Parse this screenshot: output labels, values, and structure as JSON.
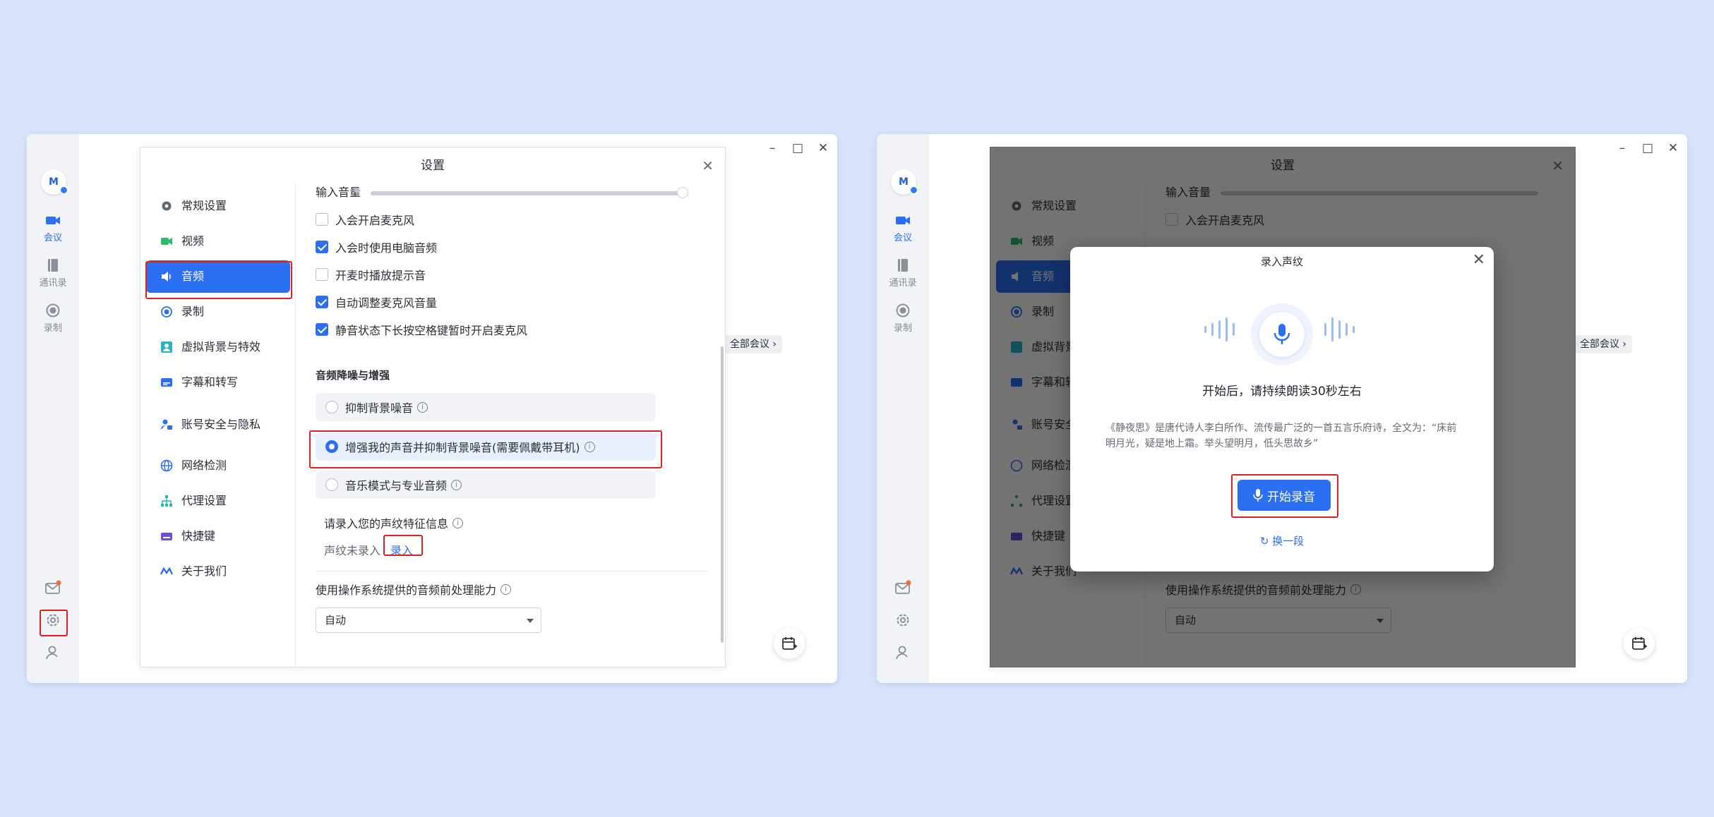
{
  "left": {
    "rail": {
      "items": [
        {
          "label": "会议",
          "icon": "video-camera-icon"
        },
        {
          "label": "通讯录",
          "icon": "contacts-book-icon"
        },
        {
          "label": "录制",
          "icon": "record-icon"
        }
      ],
      "bottom": [
        "mail-icon",
        "gear-icon",
        "user-icon"
      ]
    },
    "side_chip": "全部会议",
    "settings": {
      "title": "设置",
      "nav": [
        {
          "label": "常规设置",
          "icon": "gear-icon"
        },
        {
          "label": "视频",
          "icon": "video-camera-icon"
        },
        {
          "label": "音频",
          "icon": "speaker-icon"
        },
        {
          "label": "录制",
          "icon": "record-icon"
        },
        {
          "label": "虚拟背景与特效",
          "icon": "portrait-icon"
        },
        {
          "label": "字幕和转写",
          "icon": "subtitles-icon"
        },
        {
          "label": "账号安全与隐私",
          "icon": "account-lock-icon"
        },
        {
          "label": "网络检测",
          "icon": "globe-icon"
        },
        {
          "label": "代理设置",
          "icon": "network-tree-icon"
        },
        {
          "label": "快捷键",
          "icon": "keyboard-icon"
        },
        {
          "label": "关于我们",
          "icon": "logo-icon"
        }
      ],
      "content": {
        "input_volume": "输入音量",
        "checkboxes": [
          {
            "label": "入会开启麦克风",
            "checked": false
          },
          {
            "label": "入会时使用电脑音频",
            "checked": true
          },
          {
            "label": "开麦时播放提示音",
            "checked": false
          },
          {
            "label": "自动调整麦克风音量",
            "checked": true
          },
          {
            "label": "静音状态下长按空格键暂时开启麦克风",
            "checked": true
          }
        ],
        "noise_title": "音频降噪与增强",
        "radios": [
          {
            "label": "抑制背景噪音",
            "selected": false
          },
          {
            "label": "增强我的声音并抑制背景噪音(需要佩戴带耳机)",
            "selected": true
          },
          {
            "label": "音乐模式与专业音频",
            "selected": false
          }
        ],
        "voiceprint_prompt": "请录入您的声纹特征信息",
        "voiceprint_status": "声纹未录入",
        "voiceprint_link": "录入",
        "os_audio_label": "使用操作系统提供的音频前处理能力",
        "os_audio_value": "自动"
      }
    }
  },
  "right": {
    "dialog": {
      "title": "录入声纹",
      "hint": "开始后，请持续朗读30秒左右",
      "poem": "《静夜思》是唐代诗人李白所作、流传最广泛的一首五言乐府诗，全文为：“床前明月光，疑是地上霜。举头望明月，低头思故乡”",
      "start_button": "开始录音",
      "switch_link": "换一段"
    }
  },
  "colors": {
    "accent": "#2b6ff2",
    "highlight": "#e02020",
    "background": "#d8e3fb"
  }
}
